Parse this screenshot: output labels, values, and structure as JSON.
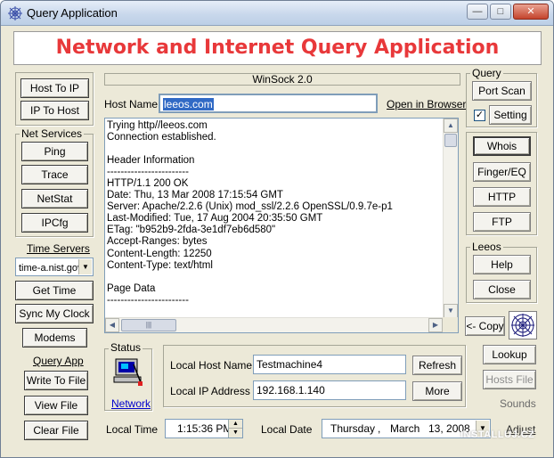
{
  "window": {
    "title": "Query Application",
    "min_glyph": "—",
    "max_glyph": "□",
    "close_glyph": "✕"
  },
  "banner": "Network and Internet Query Application",
  "winsock": "WinSock 2.0",
  "host": {
    "label": "Host Name",
    "value": "leeos.com",
    "open_browser": "Open in Browser"
  },
  "left": {
    "host_to_ip": "Host To IP",
    "ip_to_host": "IP To Host",
    "net_services": {
      "title": "Net Services",
      "ping": "Ping",
      "trace": "Trace",
      "netstat": "NetStat",
      "ipcfg": "IPCfg"
    },
    "time_servers_label": "Time Servers",
    "time_server_value": "time-a.nist.gov",
    "get_time": "Get Time",
    "sync_clock": "Sync My Clock",
    "modems": "Modems",
    "query_app": "Query App",
    "write_to_file": "Write To File",
    "view_file": "View File",
    "clear_file": "Clear File"
  },
  "log": {
    "lines": [
      "Trying http//leeos.com",
      "Connection established.",
      "",
      "Header Information",
      "------------------------",
      "HTTP/1.1 200 OK",
      "Date: Thu, 13 Mar 2008 17:15:54 GMT",
      "Server: Apache/2.2.6 (Unix) mod_ssl/2.2.6 OpenSSL/0.9.7e-p1",
      "Last-Modified: Tue, 17 Aug 2004 20:35:50 GMT",
      "ETag: \"b952b9-2fda-3e1df7eb6d580\"",
      "Accept-Ranges: bytes",
      "Content-Length: 12250",
      "Content-Type: text/html",
      "",
      "Page Data",
      "------------------------"
    ]
  },
  "right": {
    "query": {
      "title": "Query",
      "port_scan": "Port Scan",
      "setting": "Setting",
      "setting_checked": "✓"
    },
    "whois": "Whois",
    "finger": "Finger/EQ",
    "http": "HTTP",
    "ftp": "FTP",
    "leeos": {
      "title": "Leeos",
      "help": "Help",
      "close": "Close"
    },
    "copy": "<- Copy",
    "lookup": "Lookup",
    "hosts_file": "Hosts File",
    "sounds": "Sounds",
    "adjust": "Adjust"
  },
  "status": {
    "title": "Status",
    "network_link": "Network"
  },
  "local": {
    "host_label": "Local Host Name",
    "host_value": "Testmachine4",
    "refresh": "Refresh",
    "ip_label": "Local IP Address",
    "ip_value": "192.168.1.140",
    "more": "More",
    "time_label": "Local Time",
    "time_value": "1:15:36 PM",
    "date_label": "Local Date",
    "date_day": "Thursday",
    "date_sep": ",",
    "date_month": "March",
    "date_value": "13, 2008"
  },
  "watermark": "INSTALLUJ.CZ"
}
